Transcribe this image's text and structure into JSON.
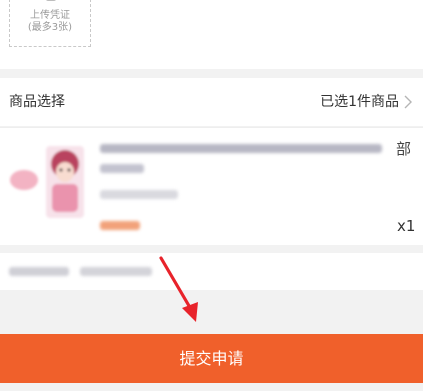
{
  "upload": {
    "label": "上传凭证",
    "limit": "(最多3张)"
  },
  "goods": {
    "title": "商品选择",
    "selected": "已选1件商品",
    "product": {
      "name_tail": "部",
      "quantity": "x1"
    }
  },
  "submit": {
    "label": "提交申请"
  },
  "colors": {
    "accent": "#f0602b",
    "annotation_arrow": "#e8232b"
  }
}
